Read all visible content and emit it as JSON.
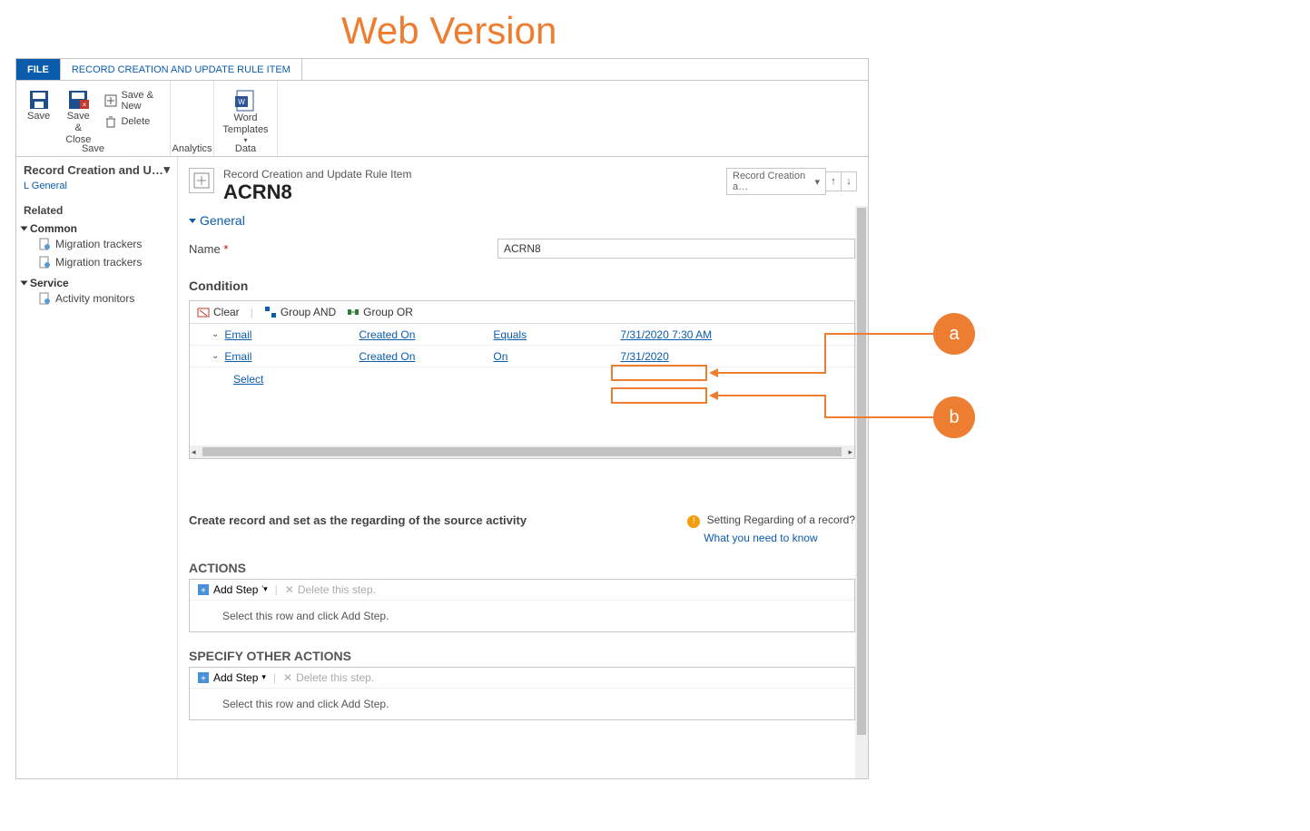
{
  "page_title_annot": "Web Version",
  "tabs": {
    "file": "FILE",
    "rule": "RECORD CREATION AND UPDATE RULE ITEM"
  },
  "ribbon": {
    "save_group": "Save",
    "save": "Save",
    "save_close": "Save &\nClose",
    "save_new": "Save & New",
    "delete": "Delete",
    "analytics_group": "Analytics",
    "data_group": "Data",
    "word_templates": "Word\nTemplates"
  },
  "nav": {
    "title": "Record Creation and U…",
    "general_link": "L General",
    "related": "Related",
    "common": "Common",
    "migration": "Migration trackers",
    "service": "Service",
    "activity": "Activity monitors"
  },
  "header": {
    "breadcrumb": "Record Creation and Update Rule Item",
    "title": "ACRN8",
    "dropdown": "Record Creation a…"
  },
  "general_section": "General",
  "name_label": "Name",
  "name_value": "ACRN8",
  "condition_label": "Condition",
  "cond_toolbar": {
    "clear": "Clear",
    "and": "Group AND",
    "or": "Group OR"
  },
  "cond_rows": [
    {
      "entity": "Email",
      "field": "Created On",
      "op": "Equals",
      "value": "7/31/2020 7:30 AM"
    },
    {
      "entity": "Email",
      "field": "Created On",
      "op": "On",
      "value": "7/31/2020"
    }
  ],
  "cond_select": "Select",
  "create_record_text": "Create record and set as the regarding of the source activity",
  "info": {
    "q": "Setting Regarding of a record?",
    "link": "What you need to know"
  },
  "actions_title": "ACTIONS",
  "specify_title": "SPECIFY OTHER ACTIONS",
  "add_step": "Add Step",
  "delete_step": "Delete this step.",
  "step_placeholder": "Select this row and click Add Step.",
  "annots": {
    "a": "a",
    "b": "b"
  }
}
